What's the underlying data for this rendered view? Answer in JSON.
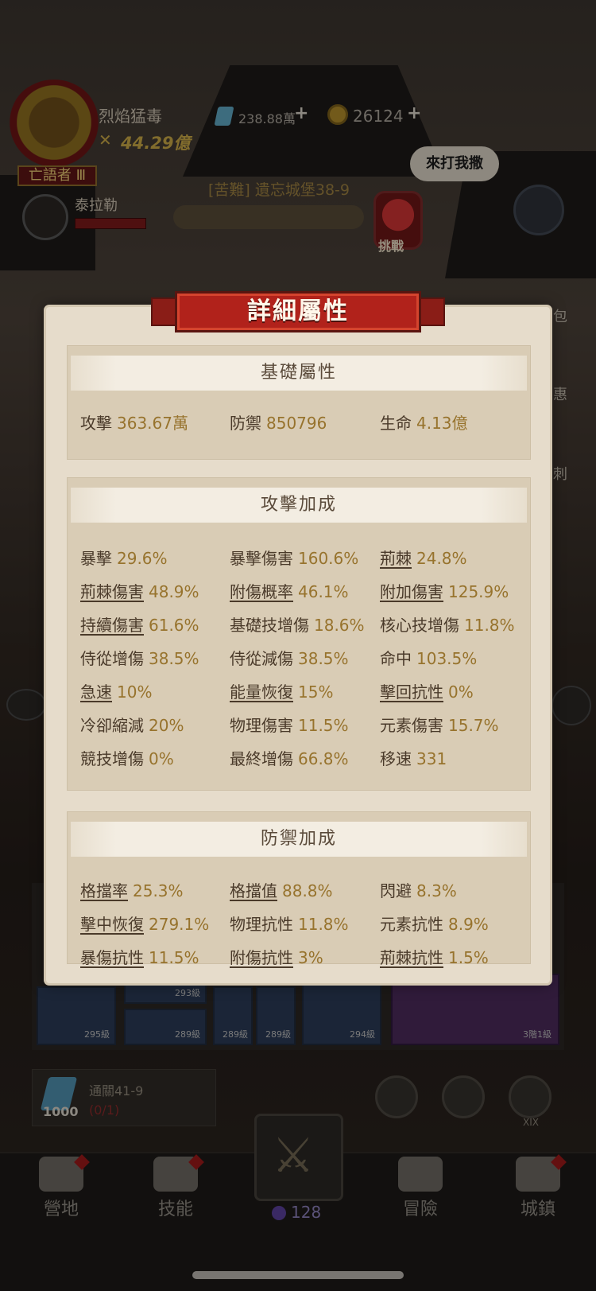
{
  "player": {
    "name": "烈焰猛毒",
    "power": "44.29億",
    "rank": "亡語者 Ⅲ",
    "gems": "238.88萬",
    "coins": "26124",
    "plus": "+"
  },
  "boss": {
    "name": "泰拉勒",
    "taunt": "來打我撒",
    "stage": "[苦難] 遺忘城堡38-9",
    "challenge": "挑戰"
  },
  "side_labels": [
    "包",
    "惠",
    "刺"
  ],
  "modal": {
    "title": "詳細屬性",
    "basic": {
      "heading": "基礎屬性",
      "stats": [
        {
          "label": "攻擊",
          "value": "363.67萬"
        },
        {
          "label": "防禦",
          "value": "850796"
        },
        {
          "label": "生命",
          "value": "4.13億"
        }
      ]
    },
    "attack": {
      "heading": "攻擊加成",
      "stats": [
        {
          "label": "暴擊",
          "value": "29.6%"
        },
        {
          "label": "暴擊傷害",
          "value": "160.6%"
        },
        {
          "label": "荊棘",
          "value": "24.8%"
        },
        {
          "label": "荊棘傷害",
          "value": "48.9%"
        },
        {
          "label": "附傷概率",
          "value": "46.1%"
        },
        {
          "label": "附加傷害",
          "value": "125.9%"
        },
        {
          "label": "持續傷害",
          "value": "61.6%"
        },
        {
          "label": "基礎技增傷",
          "value": "18.6%"
        },
        {
          "label": "核心技增傷",
          "value": "11.8%"
        },
        {
          "label": "侍從增傷",
          "value": "38.5%"
        },
        {
          "label": "侍從減傷",
          "value": "38.5%"
        },
        {
          "label": "命中",
          "value": "103.5%"
        },
        {
          "label": "急速",
          "value": "10%"
        },
        {
          "label": "能量恢復",
          "value": "15%"
        },
        {
          "label": "擊回抗性",
          "value": "0%"
        },
        {
          "label": "冷卻縮減",
          "value": "20%"
        },
        {
          "label": "物理傷害",
          "value": "11.5%"
        },
        {
          "label": "元素傷害",
          "value": "15.7%"
        },
        {
          "label": "競技增傷",
          "value": "0%"
        },
        {
          "label": "最終增傷",
          "value": "66.8%"
        },
        {
          "label": "移速",
          "value": "331"
        }
      ]
    },
    "defense": {
      "heading": "防禦加成",
      "stats": [
        {
          "label": "格擋率",
          "value": "25.3%"
        },
        {
          "label": "格擋值",
          "value": "88.8%"
        },
        {
          "label": "閃避",
          "value": "8.3%"
        },
        {
          "label": "擊中恢復",
          "value": "279.1%"
        },
        {
          "label": "物理抗性",
          "value": "11.8%"
        },
        {
          "label": "元素抗性",
          "value": "8.9%"
        },
        {
          "label": "暴傷抗性",
          "value": "11.5%"
        },
        {
          "label": "附傷抗性",
          "value": "3%"
        },
        {
          "label": "荊棘抗性",
          "value": "1.5%"
        }
      ]
    }
  },
  "equipment_levels": [
    "295級",
    "293級",
    "289級",
    "289級",
    "289級",
    "294級",
    "3階1級"
  ],
  "quest": {
    "crystal_amount": "1000",
    "title": "通關41-9",
    "progress": "(0/1)"
  },
  "roman_badge": "XIX",
  "energy": "128",
  "nav": [
    {
      "label": "營地"
    },
    {
      "label": "技能"
    },
    {
      "label": "冒險"
    },
    {
      "label": "城鎮"
    }
  ]
}
